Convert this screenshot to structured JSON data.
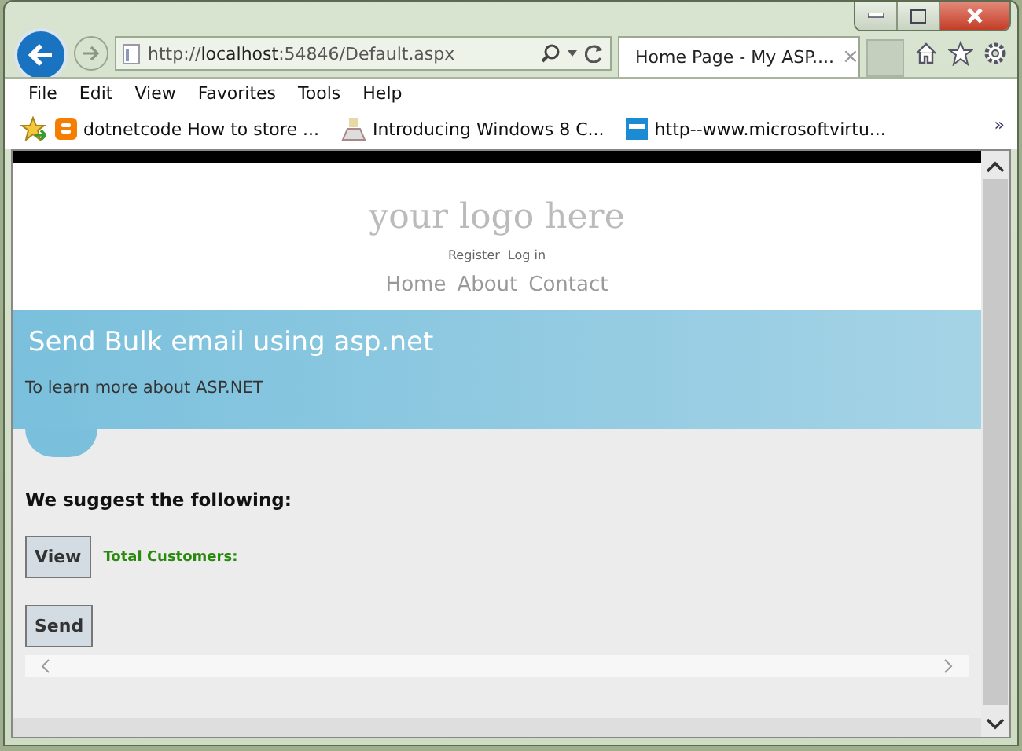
{
  "browser": {
    "address": "http://**localhost**:54846/Default.aspx",
    "tab": {
      "title": "Home Page - My ASP....",
      "close": "×",
      "selected": true
    },
    "menu": [
      "File",
      "Edit",
      "View",
      "Favorites",
      "Tools",
      "Help"
    ],
    "favorites": [
      {
        "kind": "blog",
        "label": "dotnetcode How to store ..."
      },
      {
        "kind": "app",
        "label": "Introducing Windows 8  C..."
      },
      {
        "kind": "tile",
        "label": "http--www.microsoftvirtu..."
      }
    ],
    "more": "»"
  },
  "page": {
    "logo": "your logo here",
    "account_links": [
      "Register",
      "Log in"
    ],
    "nav": [
      "Home",
      "About",
      "Contact"
    ],
    "banner": {
      "title": "Send Bulk email using asp.net",
      "subtitle": "To learn more about ASP.NET"
    },
    "heading": "We suggest the following:",
    "view_button": "View",
    "total_label": "Total Customers:",
    "send_button": "Send"
  }
}
